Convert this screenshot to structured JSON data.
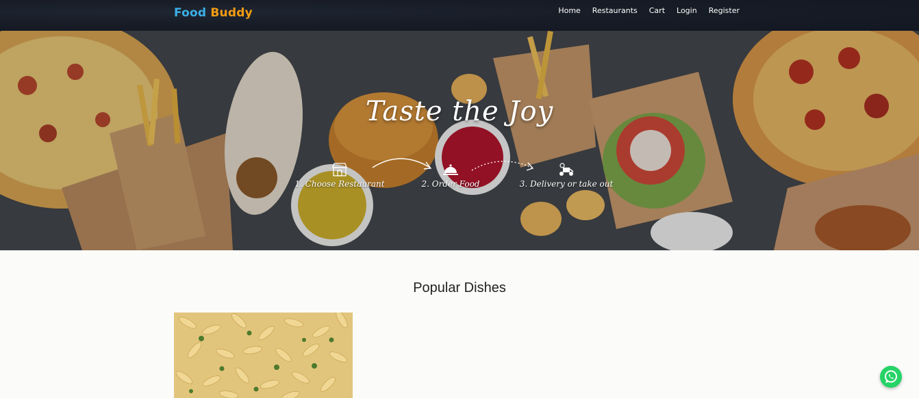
{
  "brand": {
    "part1": "Food",
    "part2": "Buddy"
  },
  "nav": {
    "items": [
      {
        "label": "Home"
      },
      {
        "label": "Restaurants"
      },
      {
        "label": "Cart"
      },
      {
        "label": "Login"
      },
      {
        "label": "Register"
      }
    ]
  },
  "hero": {
    "title": "Taste the Joy",
    "steps": [
      {
        "label": "1. Choose Restaurant",
        "icon": "store-icon"
      },
      {
        "label": "2. Order Food",
        "icon": "cloche-icon"
      },
      {
        "label": "3. Delivery or take out",
        "icon": "delivery-scooter-icon"
      }
    ]
  },
  "popular": {
    "title": "Popular Dishes",
    "dishes": [
      {
        "image": "mac-and-cheese-broccoli"
      }
    ]
  },
  "whatsapp": {
    "icon": "whatsapp-icon"
  },
  "colors": {
    "brand_blue": "#3bb0e8",
    "brand_orange": "#f39c12",
    "navbar": "#171c26",
    "whatsapp": "#25d366"
  }
}
